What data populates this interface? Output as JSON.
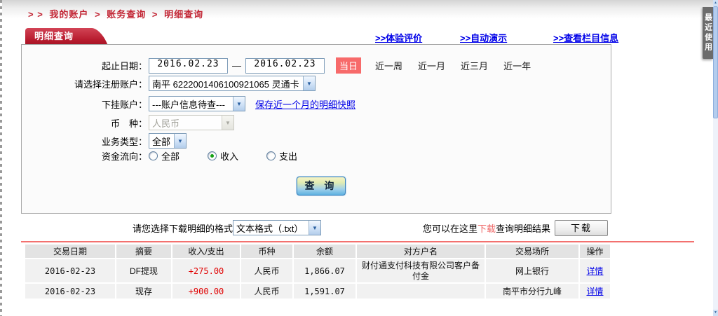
{
  "page": {
    "breadcrumb": {
      "prefix": "> >",
      "separator": ">",
      "items": [
        "我的账户",
        "账务查询",
        "明细查询"
      ]
    },
    "tab_title": "明细查询",
    "top_links": [
      ">>体验评价",
      ">>自动演示",
      ">>查看栏目信息"
    ],
    "recent_tab": "最近使用"
  },
  "form": {
    "date_label": "起止日期：",
    "date_from": "2016.02.23",
    "date_separator": "—",
    "date_to": "2016.02.23",
    "quick": {
      "active": "当日",
      "options": [
        "近一周",
        "近一月",
        "近三月",
        "近一年"
      ]
    },
    "account_label": "请选择注册账户：",
    "account_value": "南平 6222001406100921065 灵通卡",
    "sub_account_label": "下挂账户：",
    "sub_account_value": "---账户信息待查---",
    "snapshot_link": "保存近一个月的明细快照",
    "currency_label": "币　种：",
    "currency_value": "人民币",
    "biz_type_label": "业务类型：",
    "biz_type_value": "全部",
    "flow_label": "资金流向：",
    "flow_options": [
      {
        "label": "全部",
        "checked": false
      },
      {
        "label": "收入",
        "checked": true
      },
      {
        "label": "支出",
        "checked": false
      }
    ],
    "query_button": "查 询"
  },
  "download": {
    "format_label": "请您选择下载明细的格式",
    "format_value": "文本格式（.txt）",
    "hint_prefix": "您可以在这里",
    "hint_download": "下载",
    "hint_suffix": "查询明细结果",
    "button_label": "下载"
  },
  "table": {
    "headers": [
      "交易日期",
      "摘要",
      "收入/支出",
      "币种",
      "余额",
      "对方户名",
      "交易场所",
      "操作"
    ],
    "rows": [
      {
        "date": "2016-02-23",
        "summary": "DF提现",
        "amount": "+275.00",
        "currency": "人民币",
        "balance": "1,866.07",
        "counterparty": "财付通支付科技有限公司客户备付金",
        "place": "网上银行",
        "action": "详情"
      },
      {
        "date": "2016-02-23",
        "summary": "现存",
        "amount": "+900.00",
        "currency": "人民币",
        "balance": "1,591.07",
        "counterparty": "",
        "place": "南平市分行九峰",
        "action": "详情"
      }
    ]
  },
  "colors": {
    "accent_red": "#b91d30",
    "breadcrumb_red": "#c22433",
    "link_blue": "#0000e8",
    "amount_red": "#e00000",
    "quick_active_bg": "#f76a6a",
    "table_divider_red": "#f3716f",
    "header_gray": "#e3e3e3",
    "row_gray": "#f1f1f1"
  }
}
